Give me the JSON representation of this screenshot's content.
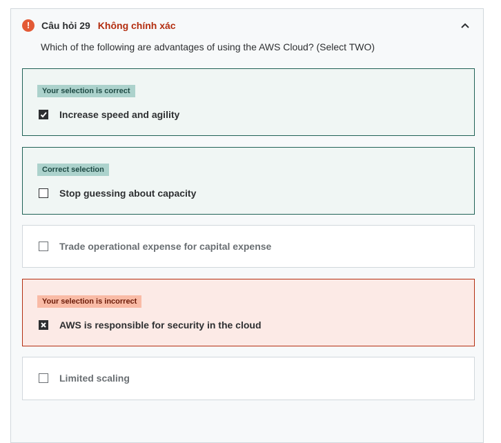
{
  "question": {
    "number_label": "Câu hỏi 29",
    "status_label": "Không chính xác",
    "text": "Which of the following are advantages of using the AWS Cloud? (Select TWO)",
    "status_icon": "error-icon",
    "collapse_icon": "chevron-up-icon"
  },
  "options": [
    {
      "badge": "Your selection is correct",
      "label": "Increase speed and agility",
      "checked": true,
      "state": "correct"
    },
    {
      "badge": "Correct selection",
      "label": "Stop guessing about capacity",
      "checked": false,
      "state": "correct"
    },
    {
      "badge": "",
      "label": "Trade operational expense for capital expense",
      "checked": false,
      "state": "neutral"
    },
    {
      "badge": "Your selection is incorrect",
      "label": "AWS is responsible for security in the cloud",
      "checked": true,
      "state": "incorrect"
    },
    {
      "badge": "",
      "label": "Limited scaling",
      "checked": false,
      "state": "neutral"
    }
  ],
  "colors": {
    "correct_border": "#1e6055",
    "incorrect_border": "#b32d0f",
    "status_text": "#b32d0f",
    "error_icon": "#e35a36"
  }
}
